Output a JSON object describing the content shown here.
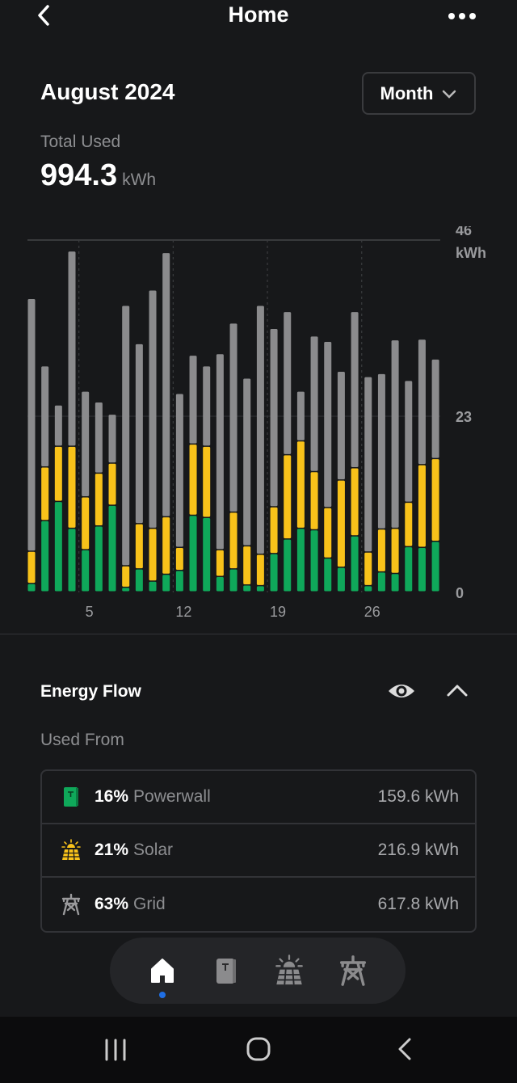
{
  "header": {
    "title": "Home",
    "back_icon": "chevron-left-icon",
    "more_icon": "more-dots-icon"
  },
  "summary": {
    "period": "August 2024",
    "range_selector": "Month",
    "total_label": "Total Used",
    "total_value": "994.3",
    "total_unit": "kWh"
  },
  "colors": {
    "powerwall": "#0fa85a",
    "solar": "#f8c21a",
    "grid": "#8b8b8d",
    "accent": "#1f6fe5",
    "background": "#17181a"
  },
  "chart_data": {
    "type": "bar",
    "stacked": true,
    "x": [
      1,
      2,
      3,
      4,
      5,
      6,
      7,
      8,
      9,
      10,
      11,
      12,
      13,
      14,
      15,
      16,
      17,
      18,
      19,
      20,
      21,
      22,
      23,
      24,
      25,
      26,
      27,
      28,
      29,
      30,
      31
    ],
    "xtick_labels": [
      "5",
      "12",
      "19",
      "26"
    ],
    "ytick_labels": [
      "0",
      "23",
      "46"
    ],
    "yunit": "kWh",
    "ylim": [
      0,
      46
    ],
    "grid": true,
    "series": [
      {
        "key": "powerwall",
        "values": [
          1.1,
          9.3,
          11.8,
          8.3,
          5.5,
          8.6,
          11.3,
          0.6,
          3.0,
          1.4,
          2.3,
          2.8,
          10.0,
          9.7,
          2.0,
          3.0,
          0.9,
          0.8,
          5.0,
          6.9,
          8.3,
          8.1,
          4.4,
          3.2,
          7.3,
          0.8,
          2.6,
          2.4,
          5.9,
          5.8,
          6.6
        ]
      },
      {
        "key": "solar",
        "values": [
          4.2,
          7.0,
          7.2,
          10.7,
          6.9,
          6.9,
          5.5,
          2.8,
          5.9,
          6.9,
          7.5,
          3.0,
          9.3,
          9.3,
          3.5,
          7.4,
          5.1,
          4.1,
          6.1,
          11.0,
          11.4,
          7.6,
          6.6,
          11.4,
          8.9,
          4.4,
          5.6,
          5.9,
          5.8,
          10.8,
          10.8
        ]
      },
      {
        "key": "grid",
        "values": [
          33.0,
          13.2,
          5.4,
          25.5,
          13.8,
          9.3,
          6.4,
          34.0,
          23.5,
          31.1,
          34.5,
          20.1,
          11.6,
          10.5,
          25.6,
          24.7,
          21.9,
          32.5,
          23.3,
          18.7,
          6.5,
          17.7,
          21.7,
          14.2,
          20.4,
          22.9,
          20.3,
          24.6,
          15.9,
          16.4,
          13.0
        ]
      }
    ]
  },
  "energy_flow": {
    "title": "Energy Flow",
    "eye_icon": "eye-icon",
    "collapse_icon": "chevron-up-icon",
    "used_from_label": "Used From",
    "sources": [
      {
        "icon": "powerwall-icon",
        "percent": "16%",
        "name": "Powerwall",
        "value": "159.6 kWh"
      },
      {
        "icon": "solar-icon",
        "percent": "21%",
        "name": "Solar",
        "value": "216.9 kWh"
      },
      {
        "icon": "grid-tower-icon",
        "percent": "63%",
        "name": "Grid",
        "value": "617.8 kWh"
      }
    ]
  },
  "bottom_tabs": [
    {
      "icon": "home-icon",
      "active": true
    },
    {
      "icon": "powerwall-icon",
      "active": false
    },
    {
      "icon": "solar-icon",
      "active": false
    },
    {
      "icon": "grid-tower-icon",
      "active": false
    }
  ],
  "system_nav": [
    "recents-icon",
    "home-circle-icon",
    "back-icon"
  ]
}
